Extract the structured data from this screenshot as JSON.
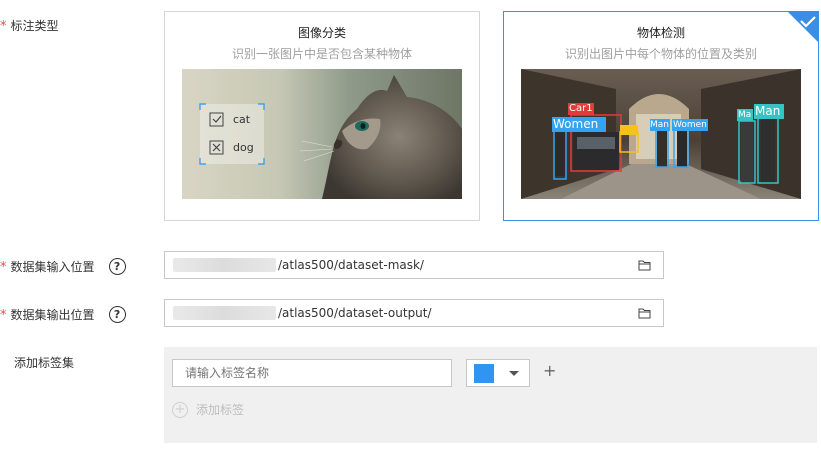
{
  "annotation_type": {
    "label": "标注类型",
    "required_mark": "*",
    "options": [
      {
        "title": "图像分类",
        "subtitle": "识别一张图片中是否包含某种物体",
        "selected": false,
        "overlay": {
          "items": [
            "cat",
            "dog"
          ]
        }
      },
      {
        "title": "物体检测",
        "subtitle": "识别出图片中每个物体的位置及类别",
        "selected": true,
        "overlay": {
          "boxes": [
            "Car1",
            "Women",
            "Man",
            "Women",
            "Ma",
            "Man"
          ]
        }
      }
    ]
  },
  "input_location": {
    "label": "数据集输入位置",
    "required_mark": "*",
    "help": "?",
    "path": "/atlas500/dataset-mask/"
  },
  "output_location": {
    "label": "数据集输出位置",
    "required_mark": "*",
    "help": "?",
    "path": "/atlas500/dataset-output/"
  },
  "label_set": {
    "label": "添加标签集",
    "name_placeholder": "请输入标签名称",
    "color": "#2e95f3",
    "plus": "+",
    "add_label": "添加标签",
    "add_icon": "+"
  },
  "colors": {
    "accent": "#3a8ee6",
    "required": "#f5484a"
  }
}
